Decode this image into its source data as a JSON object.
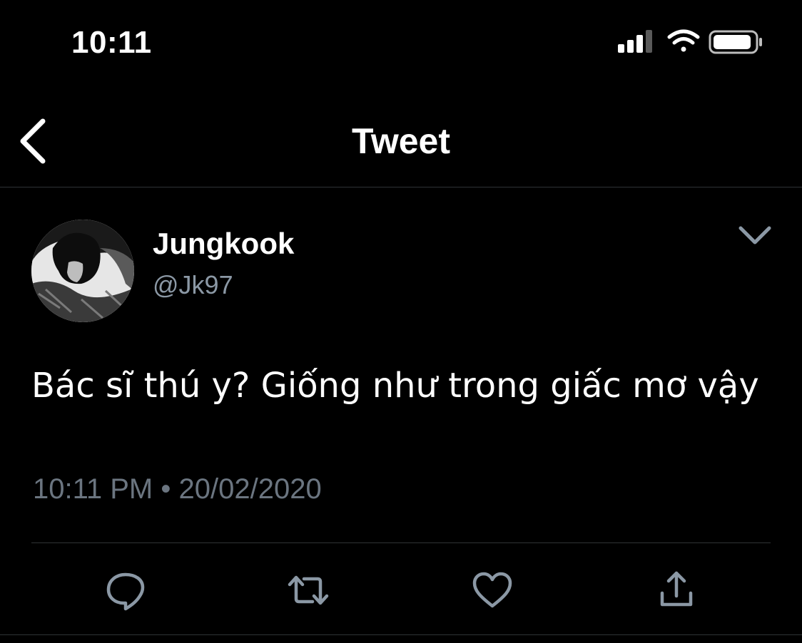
{
  "status_bar": {
    "time": "10:11",
    "icons": [
      "cellular-signal-icon",
      "wifi-icon",
      "battery-icon"
    ]
  },
  "nav": {
    "back_icon": "chevron-left-icon",
    "title": "Tweet"
  },
  "tweet": {
    "author": {
      "display_name": "Jungkook",
      "handle": "@Jk97"
    },
    "more_icon": "chevron-down-icon",
    "text": "Bác sĩ thú y? Giống như trong giấc mơ vậy",
    "time": "10:11 PM",
    "separator": "•",
    "date": "20/02/2020",
    "actions": [
      {
        "name": "reply",
        "icon": "reply-icon"
      },
      {
        "name": "retweet",
        "icon": "retweet-icon"
      },
      {
        "name": "like",
        "icon": "heart-icon"
      },
      {
        "name": "share",
        "icon": "share-icon"
      }
    ]
  },
  "colors": {
    "background": "#000000",
    "text_primary": "#ffffff",
    "text_secondary": "#8b98a5",
    "icon_gray": "#8b98a5",
    "divider": "#2f3336"
  }
}
